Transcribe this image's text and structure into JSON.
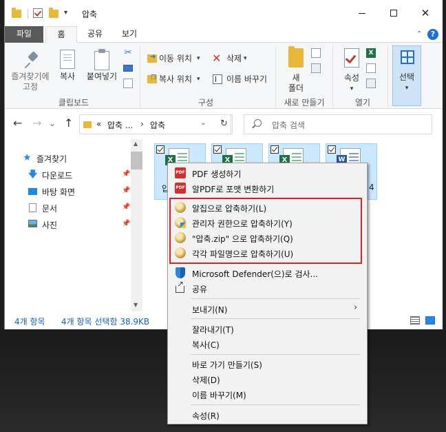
{
  "window": {
    "title": "압축",
    "qat_dropdown": "▾",
    "controls": {
      "close": "✕"
    }
  },
  "ribbon": {
    "tabs": [
      "파일",
      "홈",
      "공유",
      "보기"
    ],
    "collapse_caret": "⌃",
    "help": "?",
    "clipboard": {
      "pin_label": "즐겨찾기에\n고정",
      "copy_label": "복사",
      "paste_label": "붙여넣기",
      "scissors": "✂",
      "group_label": "클립보드"
    },
    "organize": {
      "move_to": "이동 위치",
      "copy_to": "복사 위치",
      "delete": "삭제",
      "delete_x": "✕",
      "rename": "이름 바꾸기",
      "dropdown": "▾",
      "group_label": "구성"
    },
    "new": {
      "new_folder": "새\n폴더",
      "group_label": "새로 만들기"
    },
    "open": {
      "properties": "속성",
      "excel_glyph": "X",
      "dropdown": "▾",
      "group_label": "열기"
    },
    "select": {
      "label": "선택",
      "dropdown": "▾"
    }
  },
  "address": {
    "back": "←",
    "forward": "→",
    "recent": "⌄",
    "up": "↑",
    "chevrons": "«",
    "crumb1": "압축 ...",
    "sep": "›",
    "crumb2": "압축",
    "dropdown": "⌄",
    "refresh": "↻",
    "search_placeholder": "압축 검색"
  },
  "nav": {
    "items": [
      {
        "label": "즐겨찾기",
        "icon": "star-icon"
      },
      {
        "label": "다운로드",
        "icon": "download-arrow-icon",
        "pinned": true
      },
      {
        "label": "바탕 화면",
        "icon": "desktop-icon",
        "pinned": true
      },
      {
        "label": "문서",
        "icon": "document-icon",
        "pinned": true
      },
      {
        "label": "사진",
        "icon": "pictures-icon",
        "pinned": true
      }
    ],
    "pin_glyph": "📌",
    "scroll_up": "▲",
    "scroll_down": "▼"
  },
  "files": {
    "items": [
      {
        "type": "excel",
        "label_fragment": "압"
      },
      {
        "type": "excel",
        "label_fragment": ""
      },
      {
        "type": "excel",
        "label_fragment": ""
      },
      {
        "type": "word",
        "label_fragment": "4"
      }
    ]
  },
  "status": {
    "count": "4개 항목",
    "selection": "4개 항목 선택함 38.9KB"
  },
  "context_menu": {
    "pdf_icon_text": "PDF",
    "items": [
      {
        "label": "PDF 생성하기"
      },
      {
        "label": "알PDF로 포맷 변환하기"
      },
      {
        "label": "알집으로 압축하기(L)"
      },
      {
        "label": "관리자 권한으로 압축하기(Y)"
      },
      {
        "label": "\"압축.zip\" 으로 압축하기(Q)"
      },
      {
        "label": "각각 파일명으로 압축하기(U)"
      },
      {
        "label": "Microsoft Defender(으)로 검사..."
      },
      {
        "label": "공유"
      },
      {
        "label": "보내기(N)",
        "submenu_arrow": "›"
      },
      {
        "label": "잘라내기(T)"
      },
      {
        "label": "복사(C)"
      },
      {
        "label": "바로 가기 만들기(S)"
      },
      {
        "label": "삭제(D)"
      },
      {
        "label": "이름 바꾸기(M)"
      },
      {
        "label": "속성(R)"
      }
    ],
    "highlight_color": "#e02020"
  },
  "colors": {
    "accent": "#1e6fd6",
    "selection_bg": "#cce8ff",
    "file_tab": "#595959"
  }
}
